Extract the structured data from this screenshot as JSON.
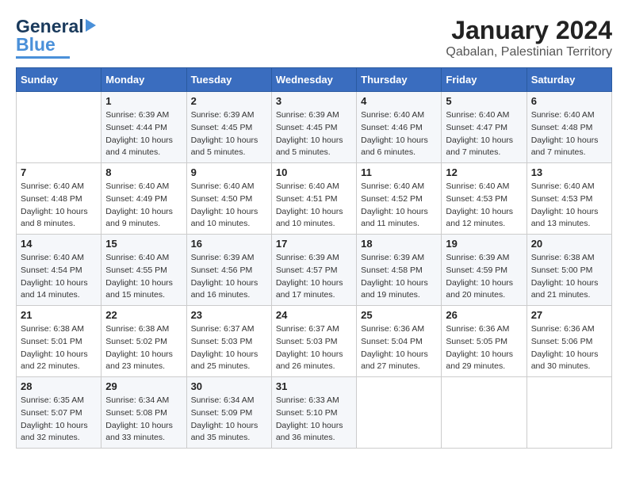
{
  "header": {
    "logo_gen": "General",
    "logo_blue": "Blue",
    "main_title": "January 2024",
    "sub_title": "Qabalan, Palestinian Territory"
  },
  "days_of_week": [
    "Sunday",
    "Monday",
    "Tuesday",
    "Wednesday",
    "Thursday",
    "Friday",
    "Saturday"
  ],
  "weeks": [
    [
      {
        "num": "",
        "info": ""
      },
      {
        "num": "1",
        "info": "Sunrise: 6:39 AM\nSunset: 4:44 PM\nDaylight: 10 hours\nand 4 minutes."
      },
      {
        "num": "2",
        "info": "Sunrise: 6:39 AM\nSunset: 4:45 PM\nDaylight: 10 hours\nand 5 minutes."
      },
      {
        "num": "3",
        "info": "Sunrise: 6:39 AM\nSunset: 4:45 PM\nDaylight: 10 hours\nand 5 minutes."
      },
      {
        "num": "4",
        "info": "Sunrise: 6:40 AM\nSunset: 4:46 PM\nDaylight: 10 hours\nand 6 minutes."
      },
      {
        "num": "5",
        "info": "Sunrise: 6:40 AM\nSunset: 4:47 PM\nDaylight: 10 hours\nand 7 minutes."
      },
      {
        "num": "6",
        "info": "Sunrise: 6:40 AM\nSunset: 4:48 PM\nDaylight: 10 hours\nand 7 minutes."
      }
    ],
    [
      {
        "num": "7",
        "info": "Sunrise: 6:40 AM\nSunset: 4:48 PM\nDaylight: 10 hours\nand 8 minutes."
      },
      {
        "num": "8",
        "info": "Sunrise: 6:40 AM\nSunset: 4:49 PM\nDaylight: 10 hours\nand 9 minutes."
      },
      {
        "num": "9",
        "info": "Sunrise: 6:40 AM\nSunset: 4:50 PM\nDaylight: 10 hours\nand 10 minutes."
      },
      {
        "num": "10",
        "info": "Sunrise: 6:40 AM\nSunset: 4:51 PM\nDaylight: 10 hours\nand 10 minutes."
      },
      {
        "num": "11",
        "info": "Sunrise: 6:40 AM\nSunset: 4:52 PM\nDaylight: 10 hours\nand 11 minutes."
      },
      {
        "num": "12",
        "info": "Sunrise: 6:40 AM\nSunset: 4:53 PM\nDaylight: 10 hours\nand 12 minutes."
      },
      {
        "num": "13",
        "info": "Sunrise: 6:40 AM\nSunset: 4:53 PM\nDaylight: 10 hours\nand 13 minutes."
      }
    ],
    [
      {
        "num": "14",
        "info": "Sunrise: 6:40 AM\nSunset: 4:54 PM\nDaylight: 10 hours\nand 14 minutes."
      },
      {
        "num": "15",
        "info": "Sunrise: 6:40 AM\nSunset: 4:55 PM\nDaylight: 10 hours\nand 15 minutes."
      },
      {
        "num": "16",
        "info": "Sunrise: 6:39 AM\nSunset: 4:56 PM\nDaylight: 10 hours\nand 16 minutes."
      },
      {
        "num": "17",
        "info": "Sunrise: 6:39 AM\nSunset: 4:57 PM\nDaylight: 10 hours\nand 17 minutes."
      },
      {
        "num": "18",
        "info": "Sunrise: 6:39 AM\nSunset: 4:58 PM\nDaylight: 10 hours\nand 19 minutes."
      },
      {
        "num": "19",
        "info": "Sunrise: 6:39 AM\nSunset: 4:59 PM\nDaylight: 10 hours\nand 20 minutes."
      },
      {
        "num": "20",
        "info": "Sunrise: 6:38 AM\nSunset: 5:00 PM\nDaylight: 10 hours\nand 21 minutes."
      }
    ],
    [
      {
        "num": "21",
        "info": "Sunrise: 6:38 AM\nSunset: 5:01 PM\nDaylight: 10 hours\nand 22 minutes."
      },
      {
        "num": "22",
        "info": "Sunrise: 6:38 AM\nSunset: 5:02 PM\nDaylight: 10 hours\nand 23 minutes."
      },
      {
        "num": "23",
        "info": "Sunrise: 6:37 AM\nSunset: 5:03 PM\nDaylight: 10 hours\nand 25 minutes."
      },
      {
        "num": "24",
        "info": "Sunrise: 6:37 AM\nSunset: 5:03 PM\nDaylight: 10 hours\nand 26 minutes."
      },
      {
        "num": "25",
        "info": "Sunrise: 6:36 AM\nSunset: 5:04 PM\nDaylight: 10 hours\nand 27 minutes."
      },
      {
        "num": "26",
        "info": "Sunrise: 6:36 AM\nSunset: 5:05 PM\nDaylight: 10 hours\nand 29 minutes."
      },
      {
        "num": "27",
        "info": "Sunrise: 6:36 AM\nSunset: 5:06 PM\nDaylight: 10 hours\nand 30 minutes."
      }
    ],
    [
      {
        "num": "28",
        "info": "Sunrise: 6:35 AM\nSunset: 5:07 PM\nDaylight: 10 hours\nand 32 minutes."
      },
      {
        "num": "29",
        "info": "Sunrise: 6:34 AM\nSunset: 5:08 PM\nDaylight: 10 hours\nand 33 minutes."
      },
      {
        "num": "30",
        "info": "Sunrise: 6:34 AM\nSunset: 5:09 PM\nDaylight: 10 hours\nand 35 minutes."
      },
      {
        "num": "31",
        "info": "Sunrise: 6:33 AM\nSunset: 5:10 PM\nDaylight: 10 hours\nand 36 minutes."
      },
      {
        "num": "",
        "info": ""
      },
      {
        "num": "",
        "info": ""
      },
      {
        "num": "",
        "info": ""
      }
    ]
  ]
}
